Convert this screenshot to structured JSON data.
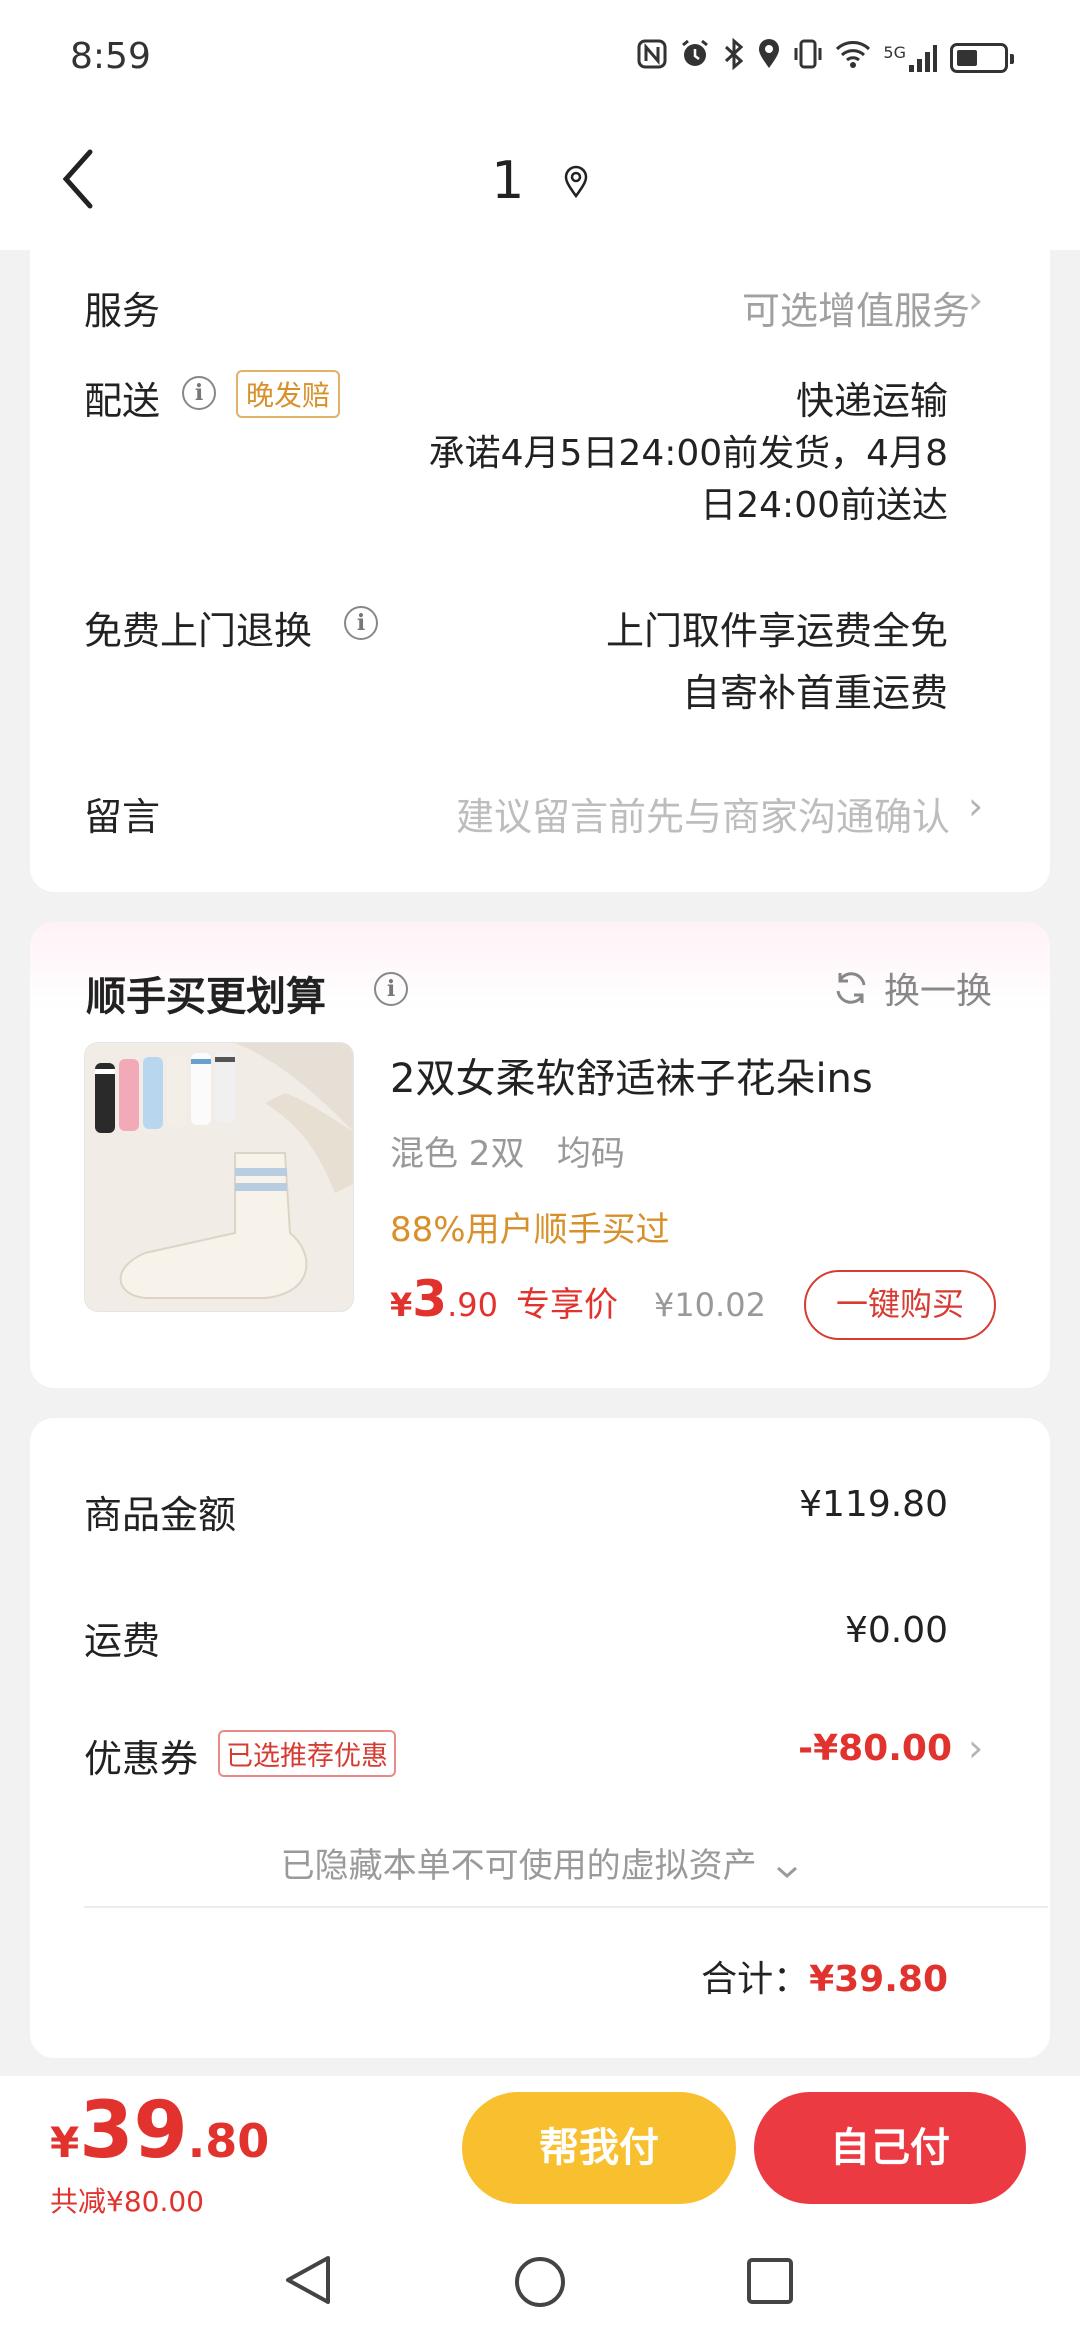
{
  "status_bar": {
    "time": "8:59",
    "network": "5G"
  },
  "header": {
    "title": "1"
  },
  "order_info": {
    "service": {
      "label": "服务",
      "value": "可选增值服务"
    },
    "delivery": {
      "label": "配送",
      "tag": "晚发赔",
      "method": "快递运输",
      "promise_line1": "承诺4月5日24:00前发货，4月8",
      "promise_line2": "日24:00前送达"
    },
    "return": {
      "label": "免费上门退换",
      "line1": "上门取件享运费全免",
      "line2": "自寄补首重运费"
    },
    "message": {
      "label": "留言",
      "placeholder": "建议留言前先与商家沟通确认"
    }
  },
  "addon": {
    "title": "顺手买更划算",
    "refresh_label": "换一换",
    "product": {
      "name": "2双女柔软舒适袜子花朵ins",
      "specs": "混色 2双   均码",
      "social_proof": "88%用户顺手买过",
      "currency": "¥",
      "price_int": "3",
      "price_dec": ".90",
      "price_label": "专享价",
      "original_price": "¥10.02",
      "buy_button": "一键购买"
    }
  },
  "summary": {
    "goods_label": "商品金额",
    "goods_value": "¥119.80",
    "shipping_label": "运费",
    "shipping_value": "¥0.00",
    "coupon_label": "优惠券",
    "coupon_tag": "已选推荐优惠",
    "coupon_value": "-¥80.00",
    "hidden_assets": "已隐藏本单不可使用的虚拟资产",
    "total_label": "合计：",
    "total_value": "¥39.80"
  },
  "bottom_bar": {
    "currency": "¥",
    "price_int": "39",
    "price_dec": ".80",
    "discount_text": "共减¥80.00",
    "pay_help_label": "帮我付",
    "pay_self_label": "自己付"
  },
  "colors": {
    "accent_red": "#e2322e",
    "help_yellow": "#f8c02e",
    "pay_red": "#ec3a42",
    "promo_orange": "#d8902a"
  }
}
